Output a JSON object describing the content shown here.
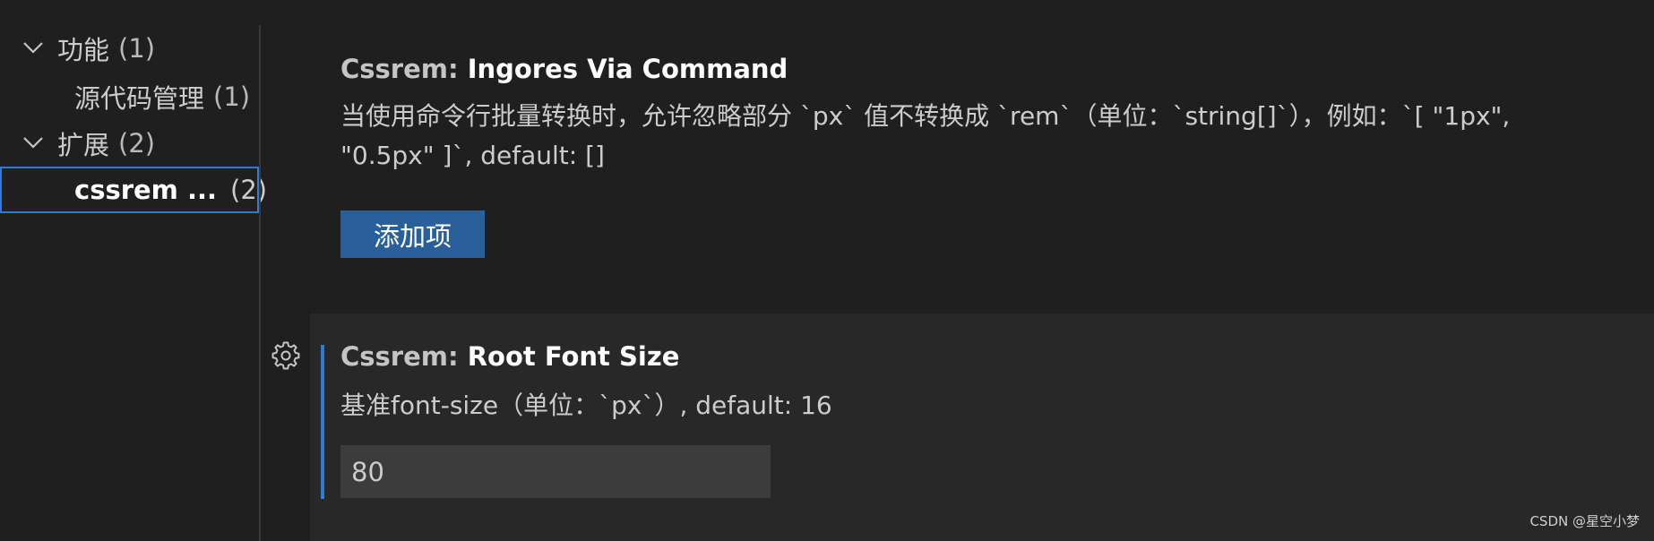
{
  "toc": {
    "items": [
      {
        "label": "功能",
        "count": "(1)",
        "expanded": true,
        "level": 0
      },
      {
        "label": "源代码管理",
        "count": "(1)",
        "level": 1
      },
      {
        "label": "扩展",
        "count": "(2)",
        "expanded": true,
        "level": 0
      },
      {
        "label": "cssrem ...",
        "count": "(2)",
        "level": 1,
        "selected": true
      }
    ]
  },
  "settings": [
    {
      "category": "Cssrem: ",
      "key": "Ingores Via Command",
      "description_line1": "当使用命令行批量转换时，允许忽略部分 `px` 值不转换成 `rem`（单位：`string[]`），例如：`[ \"1px\",",
      "description_line2": "\"0.5px\" ]`, default: []",
      "button_label": "添加项"
    },
    {
      "category": "Cssrem: ",
      "key": "Root Font Size",
      "description": "基准font-size（单位：`px`）, default: 16",
      "value": "80"
    }
  ],
  "watermark": "CSDN @星空小梦",
  "colors": {
    "background": "#1f1f1f",
    "focused_background": "#282828",
    "accent": "#2f7cd0",
    "button": "#2a6099",
    "input": "#3c3c3c"
  }
}
